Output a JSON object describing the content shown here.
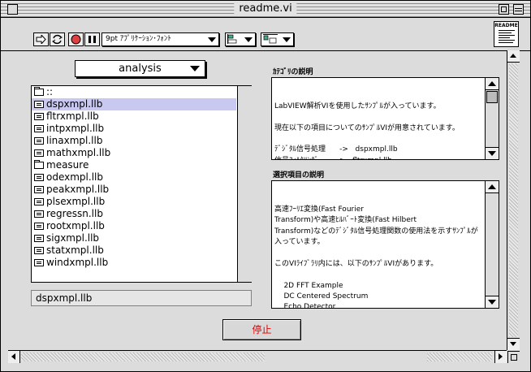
{
  "window": {
    "title": "readme.vi"
  },
  "toolbar": {
    "font_menu": "9pt ｱﾌﾟﾘｹｰｼｮﾝ･ﾌｫﾝﾄ",
    "readme_icon_label": "README"
  },
  "panel": {
    "ring_value": "analysis",
    "list": {
      "items": [
        {
          "label": "::",
          "icon": "folder-open-icon"
        },
        {
          "label": "dspxmpl.llb",
          "icon": "library-icon",
          "selected": true
        },
        {
          "label": "fltrxmpl.llb",
          "icon": "library-icon"
        },
        {
          "label": "intpxmpl.llb",
          "icon": "library-icon"
        },
        {
          "label": "linaxmpl.llb",
          "icon": "library-icon"
        },
        {
          "label": "mathxmpl.llb",
          "icon": "library-icon"
        },
        {
          "label": "measure",
          "icon": "folder-icon"
        },
        {
          "label": "odexmpl.llb",
          "icon": "library-icon"
        },
        {
          "label": "peakxmpl.llb",
          "icon": "library-icon"
        },
        {
          "label": "plsexmpl.llb",
          "icon": "library-icon"
        },
        {
          "label": "regressn.llb",
          "icon": "library-icon"
        },
        {
          "label": "rootxmpl.llb",
          "icon": "library-icon"
        },
        {
          "label": "sigxmpl.llb",
          "icon": "library-icon"
        },
        {
          "label": "statxmpl.llb",
          "icon": "library-icon"
        },
        {
          "label": "windxmpl.llb",
          "icon": "library-icon"
        }
      ]
    },
    "path_value": "dspxmpl.llb",
    "category_caption": "ｶﾃｺﾞﾘの説明",
    "category_text": "LabVIEW解析VIを使用したｻﾝﾌﾟﾙが入っています。\n\n現在以下の項目についてのｻﾝﾌﾟﾙVIが用意されています。\n\nﾃﾞｼﾞﾀﾙ信号処理      ->   dspxmpl.llb\n信号ﾌｨﾙﾀﾘﾝｸﾞ        ->   fltrxmpl.llb\n補間                ->   intpxmpl.llb\n線形代数            ->   linaxmpl.llb",
    "selection_caption": "選択項目の説明",
    "selection_text": "高速ﾌｰﾘｴ変換(Fast Fourier\nTransform)や高速ﾋﾙﾊﾞｰﾄ変換(Fast Hilbert\nTransform)などのﾃﾞｼﾞﾀﾙ信号処理関数の使用法を示すｻﾝﾌﾟﾙが\n入っています。\n\nこのVIﾗｲﾌﾞﾗﾘ内には、以下のｻﾝﾌﾟﾙVIがあります。\n\n    2D FFT Example\n    DC Centered Spectrum\n    Echo Detector\n    Parseval's Theorem",
    "stop_button": "停止"
  },
  "colors": {
    "stop_text": "#e00000",
    "selection_highlight": "#c8c8f0"
  }
}
